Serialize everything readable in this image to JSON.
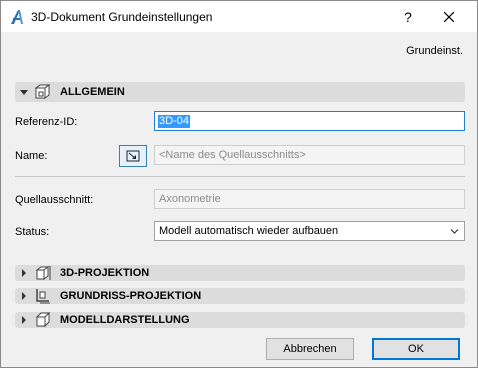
{
  "window": {
    "title": "3D-Dokument Grundeinstellungen",
    "help_label": "?"
  },
  "preset_label": "Grundeinst.",
  "sections": {
    "general": {
      "label": "ALLGEMEIN",
      "icon": "3d-document-icon",
      "expanded": true
    },
    "projection": {
      "label": "3D-PROJEKTION",
      "icon": "3d-projection-icon",
      "expanded": false
    },
    "floorplan": {
      "label": "GRUNDRISS-PROJEKTION",
      "icon": "floorplan-projection-icon",
      "expanded": false
    },
    "model": {
      "label": "MODELLDARSTELLUNG",
      "icon": "model-display-icon",
      "expanded": false
    }
  },
  "fields": {
    "reference_id": {
      "label": "Referenz-ID:",
      "value": "3D-04"
    },
    "name": {
      "label": "Name:",
      "placeholder": "<Name des Quellausschnitts>"
    },
    "source": {
      "label": "Quellausschnitt:",
      "value": "Axonometrie"
    },
    "status": {
      "label": "Status:",
      "value": "Modell automatisch wieder aufbauen"
    }
  },
  "buttons": {
    "cancel": "Abbrechen",
    "ok": "OK"
  },
  "colors": {
    "accent": "#1f7fd6",
    "selection": "#3399ff",
    "section_bar": "#dcdcdc"
  }
}
